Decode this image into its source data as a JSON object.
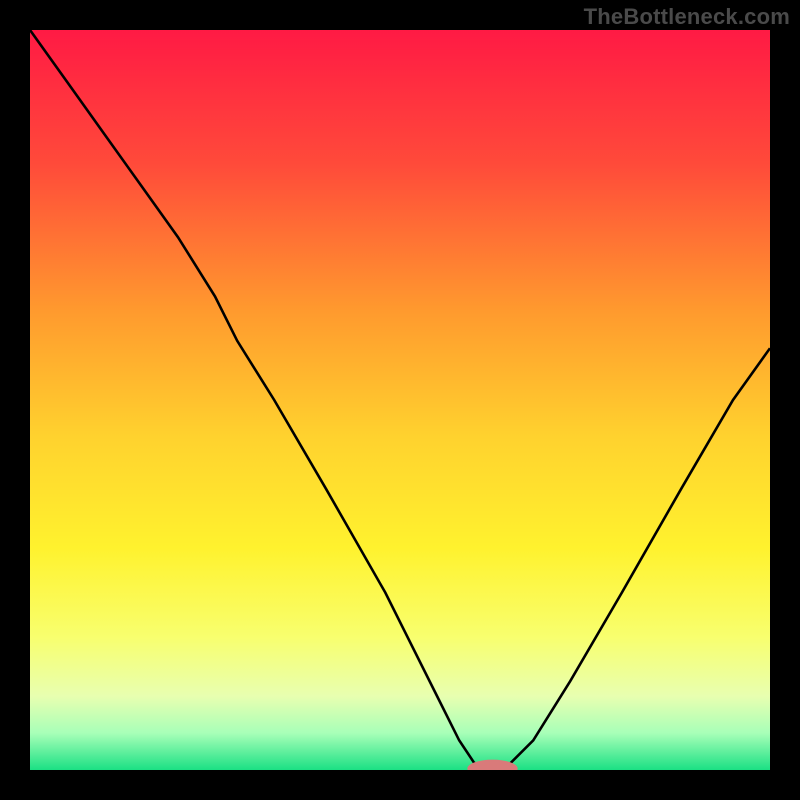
{
  "watermark": "TheBottleneck.com",
  "chart_data": {
    "type": "line",
    "title": "",
    "xlabel": "",
    "ylabel": "",
    "xlim": [
      0,
      100
    ],
    "ylim": [
      0,
      100
    ],
    "background_gradient_stops": [
      {
        "pct": 0,
        "color": "#ff1a44"
      },
      {
        "pct": 18,
        "color": "#ff4a3a"
      },
      {
        "pct": 38,
        "color": "#ff9a2e"
      },
      {
        "pct": 55,
        "color": "#ffd22e"
      },
      {
        "pct": 70,
        "color": "#fff22e"
      },
      {
        "pct": 82,
        "color": "#f8ff6e"
      },
      {
        "pct": 90,
        "color": "#e8ffb0"
      },
      {
        "pct": 95,
        "color": "#a8ffb8"
      },
      {
        "pct": 100,
        "color": "#1be084"
      }
    ],
    "series": [
      {
        "name": "bottleneck-curve",
        "x": [
          0,
          5,
          10,
          15,
          20,
          25,
          28,
          33,
          40,
          48,
          55,
          58,
          60,
          62,
          64,
          68,
          73,
          80,
          88,
          95,
          100
        ],
        "y": [
          100,
          93,
          86,
          79,
          72,
          64,
          58,
          50,
          38,
          24,
          10,
          4,
          1,
          0,
          0,
          4,
          12,
          24,
          38,
          50,
          57
        ]
      }
    ],
    "marker": {
      "name": "optimal-marker",
      "x": 62.5,
      "y": 0.2,
      "color": "#d97a7a",
      "rx": 3.4,
      "ry": 1.2
    }
  }
}
